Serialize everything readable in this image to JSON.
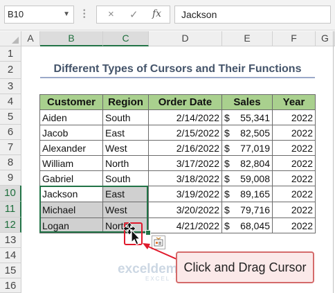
{
  "formula_bar": {
    "name_box": "B10",
    "cancel_icon": "×",
    "enter_icon": "✓",
    "fx_label": "fx",
    "formula": "Jackson"
  },
  "columns": [
    "A",
    "B",
    "C",
    "D",
    "E",
    "F",
    "G"
  ],
  "rows": [
    "1",
    "2",
    "3",
    "4",
    "5",
    "6",
    "7",
    "8",
    "9",
    "10",
    "11",
    "12",
    "13",
    "14",
    "15",
    "16"
  ],
  "title": "Different Types of Cursors and Their Functions",
  "table": {
    "headers": [
      "Customer",
      "Region",
      "Order Date",
      "Sales",
      "Year"
    ],
    "rows": [
      {
        "customer": "Aiden",
        "region": "South",
        "date": "2/14/2022",
        "currency": "$",
        "sales": "55,341",
        "year": "2022"
      },
      {
        "customer": "Jacob",
        "region": "East",
        "date": "2/15/2022",
        "currency": "$",
        "sales": "82,505",
        "year": "2022"
      },
      {
        "customer": "Alexander",
        "region": "West",
        "date": "2/16/2022",
        "currency": "$",
        "sales": "77,019",
        "year": "2022"
      },
      {
        "customer": "William",
        "region": "North",
        "date": "3/17/2022",
        "currency": "$",
        "sales": "82,804",
        "year": "2022"
      },
      {
        "customer": "Gabriel",
        "region": "South",
        "date": "3/18/2022",
        "currency": "$",
        "sales": "59,008",
        "year": "2022"
      },
      {
        "customer": "Jackson",
        "region": "East",
        "date": "3/19/2022",
        "currency": "$",
        "sales": "89,165",
        "year": "2022"
      },
      {
        "customer": "Michael",
        "region": "West",
        "date": "3/20/2022",
        "currency": "$",
        "sales": "79,716",
        "year": "2022"
      },
      {
        "customer": "Logan",
        "region": "North",
        "date": "4/21/2022",
        "currency": "$",
        "sales": "68,045",
        "year": "2022"
      }
    ]
  },
  "callout": "Click and Drag Cursor",
  "watermark": {
    "brand": "exceldemy",
    "tagline": "EXCEL · DATA · BI"
  },
  "colors": {
    "header_fill": "#a9d08e",
    "selection": "#217346",
    "title_text": "#44546a",
    "callout_border": "#d46a6a",
    "arrow": "#e0192b"
  },
  "icons": [
    "move-cursor-icon",
    "quick-analysis-icon",
    "dropdown-icon"
  ]
}
